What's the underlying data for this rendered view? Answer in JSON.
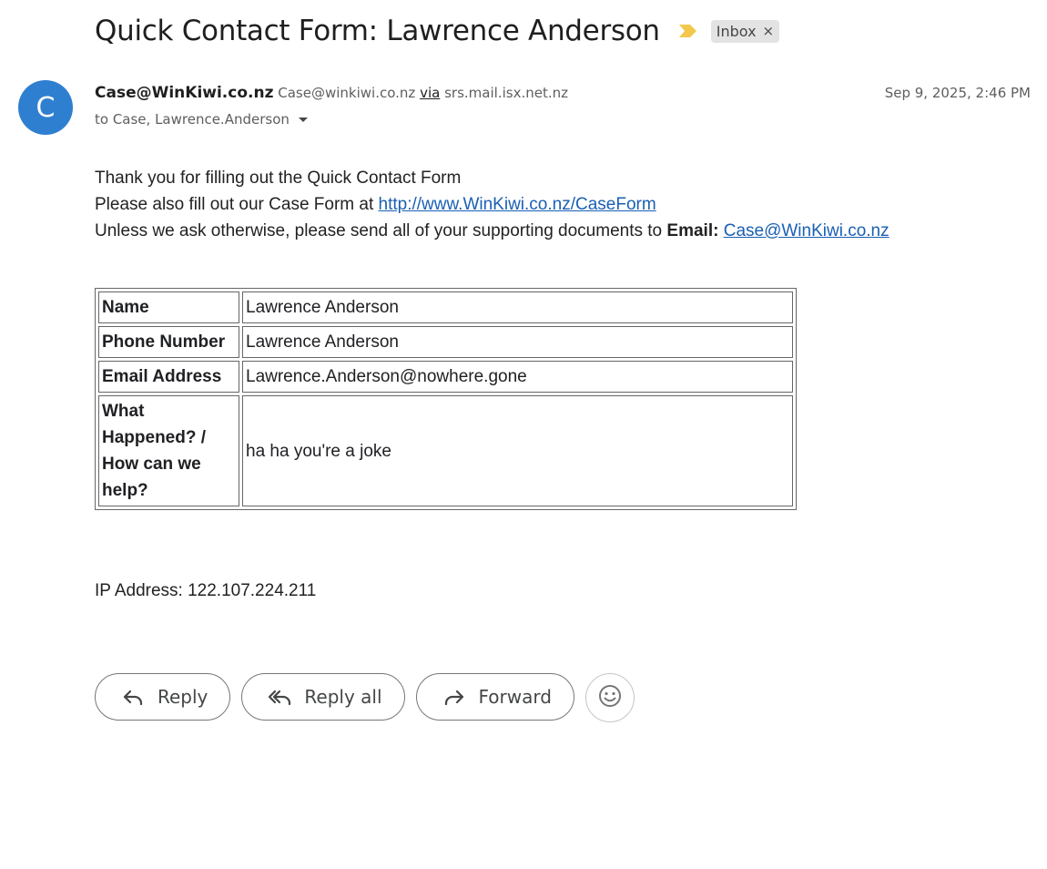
{
  "email": {
    "subject": "Quick Contact Form: Lawrence Anderson",
    "label": "Inbox",
    "label_remove": "×",
    "avatar_letter": "C",
    "sender_name": "Case@WinKiwi.co.nz",
    "sender_address": "Case@winkiwi.co.nz",
    "via_label": "via",
    "via_domain": "srs.mail.isx.net.nz",
    "date": "Sep 9, 2025, 2:46 PM",
    "recipients": "to Case, Lawrence.Anderson"
  },
  "body": {
    "line1": "Thank you for filling out the Quick Contact Form",
    "line2_prefix": "Please also fill out our Case Form at ",
    "line2_link": "http://www.WinKiwi.co.nz/CaseForm",
    "line3_prefix": "Unless we ask otherwise, please send all of your supporting documents to ",
    "line3_bold": "Email:",
    "line3_link": "Case@WinKiwi.co.nz"
  },
  "form_table": [
    {
      "key": "Name",
      "value": "Lawrence Anderson"
    },
    {
      "key": "Phone Number",
      "value": "Lawrence Anderson"
    },
    {
      "key": "Email Address",
      "value": "Lawrence.Anderson@nowhere.gone"
    },
    {
      "key": "What Happened? / How can we help?",
      "value": "ha ha you're a joke"
    }
  ],
  "ip_line": "IP Address: 122.107.224.211",
  "actions": {
    "reply": "Reply",
    "reply_all": "Reply all",
    "forward": "Forward"
  },
  "colors": {
    "avatar": "#2f7fd1",
    "importance": "#f2c94c",
    "link": "#1a5fb4"
  }
}
